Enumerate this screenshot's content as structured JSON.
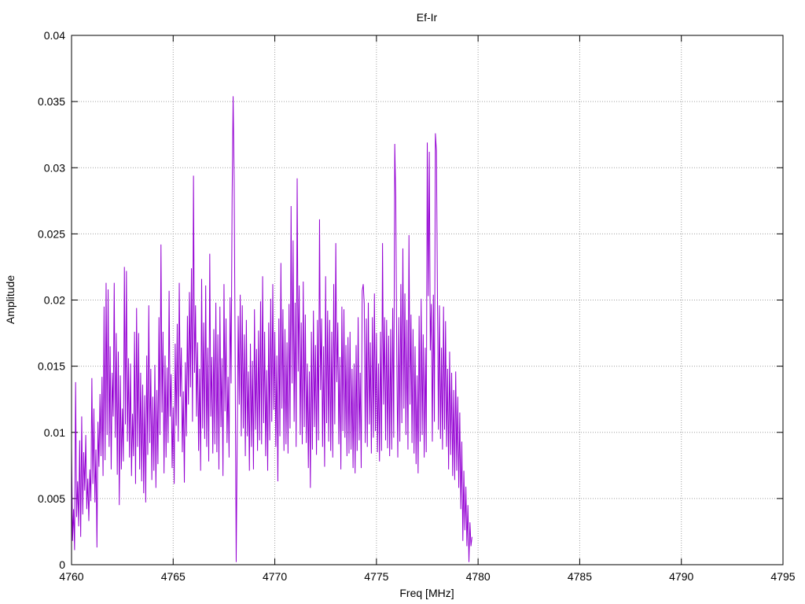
{
  "chart_data": {
    "type": "line",
    "title": "Ef-Ir",
    "xlabel": "Freq [MHz]",
    "ylabel": "Amplitude",
    "xlim": [
      4760,
      4795
    ],
    "ylim": [
      0,
      0.04
    ],
    "x_ticks": [
      "4760",
      "4765",
      "4770",
      "4775",
      "4780",
      "4785",
      "4790",
      "4795"
    ],
    "y_ticks": [
      "0",
      "0.005",
      "0.01",
      "0.015",
      "0.02",
      "0.025",
      "0.03",
      "0.035",
      "0.04"
    ],
    "grid": true,
    "grid_style": "dotted",
    "line_color": "#9400d3",
    "series": [
      {
        "x_start": 4760.0,
        "x_step": 0.05,
        "values": [
          0.0089,
          0.0018,
          0.0042,
          0.0011,
          0.0138,
          0.0036,
          0.0063,
          0.0029,
          0.0094,
          0.0021,
          0.0112,
          0.0038,
          0.0085,
          0.0056,
          0.0098,
          0.0042,
          0.0065,
          0.0033,
          0.0072,
          0.0048,
          0.0141,
          0.0061,
          0.0118,
          0.0047,
          0.0087,
          0.0013,
          0.0108,
          0.0074,
          0.0129,
          0.0082,
          0.0142,
          0.0067,
          0.0195,
          0.0079,
          0.0213,
          0.0098,
          0.0208,
          0.0089,
          0.0165,
          0.0072,
          0.0145,
          0.0112,
          0.0213,
          0.0096,
          0.0175,
          0.0068,
          0.0161,
          0.0045,
          0.0143,
          0.0072,
          0.0118,
          0.0078,
          0.0225,
          0.0106,
          0.0222,
          0.0093,
          0.0156,
          0.0081,
          0.0152,
          0.0067,
          0.0114,
          0.0082,
          0.0176,
          0.0061,
          0.0194,
          0.0089,
          0.0175,
          0.0072,
          0.0145,
          0.0063,
          0.0136,
          0.0054,
          0.0128,
          0.0047,
          0.0158,
          0.0083,
          0.0196,
          0.0092,
          0.0148,
          0.0064,
          0.0127,
          0.0071,
          0.0151,
          0.0058,
          0.0132,
          0.0076,
          0.0187,
          0.0098,
          0.0242,
          0.0115,
          0.0176,
          0.0069,
          0.0158,
          0.0081,
          0.0149,
          0.0092,
          0.0207,
          0.0112,
          0.0144,
          0.0073,
          0.0119,
          0.0061,
          0.0167,
          0.0105,
          0.0182,
          0.0093,
          0.0213,
          0.0127,
          0.0164,
          0.0085,
          0.0131,
          0.0062,
          0.0153,
          0.0097,
          0.0188,
          0.0121,
          0.0206,
          0.0134,
          0.0224,
          0.0108,
          0.0294,
          0.0145,
          0.0196,
          0.0112,
          0.0168,
          0.0086,
          0.0148,
          0.0071,
          0.0216,
          0.0103,
          0.0183,
          0.0095,
          0.0211,
          0.0089,
          0.0164,
          0.0078,
          0.0235,
          0.0112,
          0.0157,
          0.0084,
          0.0178,
          0.0091,
          0.0198,
          0.0085,
          0.0174,
          0.0072,
          0.0195,
          0.0104,
          0.0156,
          0.0067,
          0.0212,
          0.0116,
          0.0186,
          0.0092,
          0.0142,
          0.0081,
          0.0202,
          0.0137,
          0.0278,
          0.0354,
          0.0291,
          0.0156,
          0.0002,
          0.0094,
          0.0188,
          0.0121,
          0.0204,
          0.0097,
          0.0196,
          0.0103,
          0.0174,
          0.0082,
          0.0185,
          0.0097,
          0.0146,
          0.0071,
          0.0167,
          0.0089,
          0.0154,
          0.0072,
          0.0193,
          0.0102,
          0.0163,
          0.0086,
          0.0177,
          0.0094,
          0.0199,
          0.0091,
          0.0218,
          0.0107,
          0.0176,
          0.0082,
          0.0147,
          0.0071,
          0.0183,
          0.0094,
          0.0201,
          0.0108,
          0.0212,
          0.0117,
          0.0176,
          0.0089,
          0.0158,
          0.0063,
          0.0186,
          0.0097,
          0.0228,
          0.0118,
          0.0193,
          0.0086,
          0.0178,
          0.0091,
          0.0168,
          0.0084,
          0.0197,
          0.0103,
          0.0271,
          0.0137,
          0.0245,
          0.0108,
          0.0198,
          0.0089,
          0.0292,
          0.0146,
          0.0211,
          0.0098,
          0.0183,
          0.0091,
          0.0214,
          0.0104,
          0.0189,
          0.0092,
          0.0152,
          0.0073,
          0.0146,
          0.0058,
          0.0176,
          0.0087,
          0.0192,
          0.0104,
          0.0166,
          0.0083,
          0.0185,
          0.0094,
          0.0261,
          0.0132,
          0.0186,
          0.0089,
          0.0165,
          0.0074,
          0.0218,
          0.0107,
          0.0192,
          0.0093,
          0.0185,
          0.0086,
          0.0176,
          0.0081,
          0.0212,
          0.0106,
          0.0243,
          0.0138,
          0.0183,
          0.0091,
          0.0157,
          0.0072,
          0.0195,
          0.0101,
          0.0193,
          0.0096,
          0.0166,
          0.0082,
          0.0172,
          0.0084,
          0.0176,
          0.0087,
          0.0148,
          0.0073,
          0.0152,
          0.0069,
          0.0166,
          0.0086,
          0.0187,
          0.0094,
          0.0145,
          0.0073,
          0.0207,
          0.0212,
          0.0197,
          0.0092,
          0.0186,
          0.0089,
          0.0198,
          0.0106,
          0.0168,
          0.0084,
          0.0187,
          0.0096,
          0.0205,
          0.0101,
          0.0175,
          0.0085,
          0.0152,
          0.0078,
          0.0176,
          0.0086,
          0.0243,
          0.0121,
          0.0187,
          0.0094,
          0.0185,
          0.0088,
          0.0173,
          0.0082,
          0.0178,
          0.0087,
          0.0194,
          0.0096,
          0.0318,
          0.0278,
          0.0157,
          0.0081,
          0.0187,
          0.0093,
          0.0212,
          0.0107,
          0.0239,
          0.0118,
          0.0205,
          0.0098,
          0.0185,
          0.0087,
          0.0249,
          0.0121,
          0.0189,
          0.0092,
          0.0178,
          0.0084,
          0.0165,
          0.0076,
          0.0143,
          0.0069,
          0.0188,
          0.0093,
          0.0201,
          0.0098,
          0.0174,
          0.0081,
          0.0164,
          0.0085,
          0.0319,
          0.0203,
          0.0312,
          0.0162,
          0.0197,
          0.0093,
          0.0204,
          0.0108,
          0.0326,
          0.0313,
          0.0206,
          0.0102,
          0.0196,
          0.0095,
          0.0164,
          0.0087,
          0.0195,
          0.0102,
          0.0184,
          0.0089,
          0.0148,
          0.0072,
          0.0161,
          0.0083,
          0.0145,
          0.0067,
          0.0132,
          0.0064,
          0.0146,
          0.0071,
          0.0127,
          0.0058,
          0.0115,
          0.0042,
          0.0093,
          0.0018,
          0.0071,
          0.0026,
          0.0059,
          0.0014,
          0.0045,
          0.0002,
          0.0032,
          0.0014,
          0.0021
        ]
      }
    ]
  }
}
